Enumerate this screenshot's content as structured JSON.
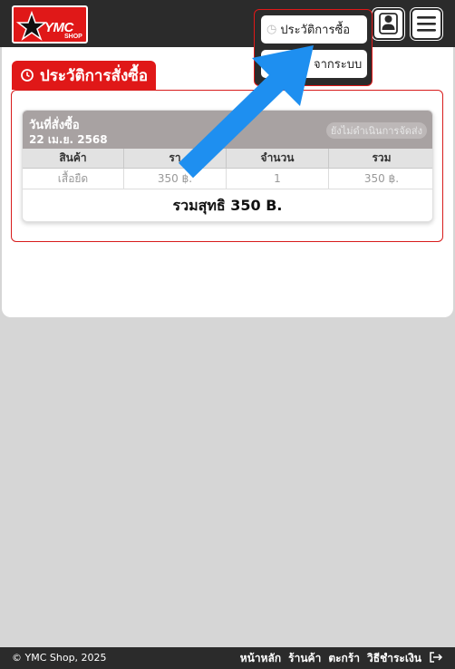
{
  "brand": {
    "logo_text": "YMC",
    "logo_subtext": "SHOP"
  },
  "header": {
    "menu": [
      {
        "label": "ประวัติการซื้อ",
        "icon": "history-icon"
      },
      {
        "label": "จากระบบ",
        "icon": "logout-icon"
      }
    ],
    "user_icon": "user-icon",
    "hamburger_icon": "menu-icon"
  },
  "section": {
    "title": "ประวัติการสั่งซื้อ",
    "icon": "history-icon"
  },
  "order": {
    "date_label": "วันที่สั่งซื้อ",
    "date": "22 เม.ย. 2568",
    "status": "ยังไม่ดำเนินการจัดส่ง",
    "columns": [
      "สินค้า",
      "รา",
      "จำนวน",
      "รวม"
    ],
    "rows": [
      [
        "เสื้อยืด",
        "350 ฿.",
        "1",
        "350 ฿."
      ]
    ],
    "total": "รวมสุทธิ  350 B."
  },
  "footer": {
    "copyright": "© YMC Shop, 2025",
    "links": [
      "หน้าหลัก",
      "ร้านค้า",
      "ตะกร้า",
      "วิธีชำระเงิน"
    ],
    "exit_icon": "exit-icon"
  },
  "colors": {
    "brand_red": "#e01818",
    "dark": "#2b2b2b",
    "arrow_blue": "#1e8ff0"
  }
}
